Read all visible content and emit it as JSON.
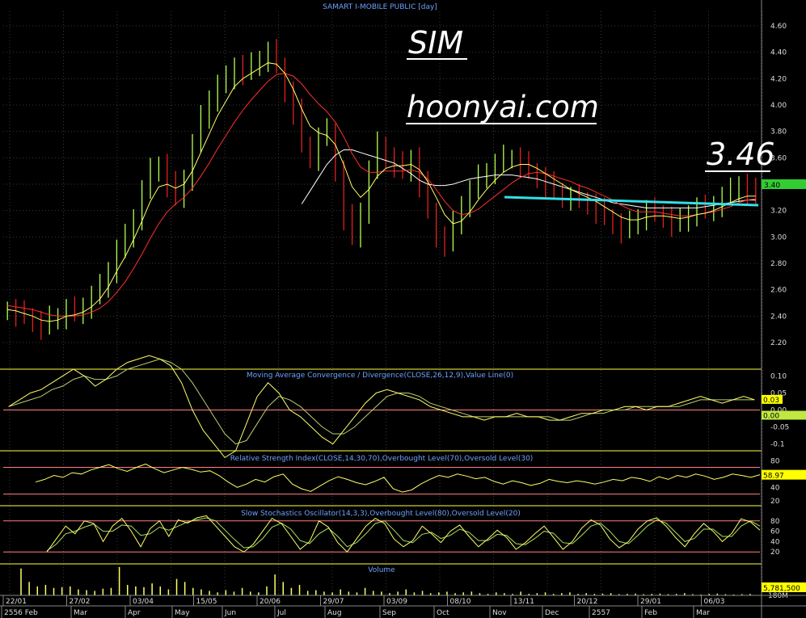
{
  "app_title": "SAMART I-MOBILE PUBLIC [day]",
  "annotations": {
    "symbol": "SIM",
    "website": "hoonyai.com",
    "price_label": "3.46"
  },
  "colors": {
    "background": "#000000",
    "price_up": "#b4ff50",
    "price_down": "#e02020",
    "ma_fast": "#ffff66",
    "ma_mid": "#ff3030",
    "ma_slow": "#ffffff",
    "support_line": "#33e0e8",
    "grid": "#3a3a3a",
    "divider": "#ffff40",
    "title_blue": "#6ea0ff",
    "label_box": "#ffff00",
    "current_price_box": "#33cc33"
  },
  "chart_data": [
    {
      "type": "line",
      "title": "SAMART I-MOBILE PUBLIC [day]",
      "panel": "price",
      "y_ticks": [
        "4.60",
        "4.40",
        "4.20",
        "4.00",
        "3.80",
        "3.60",
        "3.40",
        "3.20",
        "3.00",
        "2.80",
        "2.60",
        "2.40",
        "2.20"
      ],
      "ylim": [
        2.2,
        4.6
      ],
      "last_value": "3.40",
      "series": [
        {
          "values": [
            2.45,
            2.42,
            2.4,
            2.36,
            2.32,
            2.38,
            2.4,
            2.45,
            2.42,
            2.48,
            2.55,
            2.62,
            2.75,
            2.9,
            3.0,
            3.15,
            3.35,
            3.5,
            3.55,
            3.4,
            3.3,
            3.45,
            3.7,
            3.9,
            4.05,
            4.15,
            4.2,
            4.3,
            4.25,
            4.3,
            4.35,
            4.4,
            4.3,
            4.1,
            3.95,
            3.7,
            3.6,
            3.75,
            3.8,
            3.5,
            3.15,
            3.0,
            3.2,
            3.5,
            3.7,
            3.6,
            3.55,
            3.5,
            3.6,
            3.4,
            3.2,
            3.0,
            2.95,
            3.1,
            3.25,
            3.35,
            3.45,
            3.5,
            3.55,
            3.6,
            3.6,
            3.55,
            3.5,
            3.45,
            3.4,
            3.35,
            3.3,
            3.3,
            3.28,
            3.25,
            3.2,
            3.15,
            3.1,
            3.05,
            3.1,
            3.15,
            3.2,
            3.18,
            3.15,
            3.1,
            3.12,
            3.18,
            3.22,
            3.2,
            3.25,
            3.3,
            3.35,
            3.4,
            3.35,
            3.3
          ]
        },
        {
          "values": [
            2.45,
            2.44,
            2.42,
            2.4,
            2.37,
            2.36,
            2.37,
            2.4,
            2.41,
            2.43,
            2.47,
            2.53,
            2.62,
            2.74,
            2.85,
            2.98,
            3.12,
            3.27,
            3.38,
            3.4,
            3.37,
            3.4,
            3.5,
            3.64,
            3.78,
            3.92,
            4.03,
            4.14,
            4.2,
            4.24,
            4.28,
            4.32,
            4.31,
            4.24,
            4.12,
            3.97,
            3.84,
            3.79,
            3.77,
            3.7,
            3.55,
            3.38,
            3.3,
            3.36,
            3.46,
            3.52,
            3.54,
            3.54,
            3.55,
            3.51,
            3.42,
            3.3,
            3.17,
            3.1,
            3.12,
            3.19,
            3.28,
            3.36,
            3.43,
            3.49,
            3.53,
            3.55,
            3.55,
            3.52,
            3.48,
            3.44,
            3.4,
            3.36,
            3.33,
            3.3,
            3.27,
            3.23,
            3.19,
            3.15,
            3.13,
            3.13,
            3.15,
            3.16,
            3.16,
            3.15,
            3.14,
            3.15,
            3.17,
            3.18,
            3.2,
            3.23,
            3.26,
            3.29,
            3.31,
            3.31
          ]
        },
        {
          "values": [
            2.48,
            2.47,
            2.46,
            2.45,
            2.43,
            2.41,
            2.4,
            2.4,
            2.4,
            2.41,
            2.43,
            2.46,
            2.51,
            2.58,
            2.66,
            2.76,
            2.87,
            2.99,
            3.1,
            3.19,
            3.25,
            3.3,
            3.37,
            3.46,
            3.56,
            3.67,
            3.77,
            3.87,
            3.96,
            4.04,
            4.11,
            4.18,
            4.23,
            4.24,
            4.22,
            4.16,
            4.08,
            4.01,
            3.95,
            3.87,
            3.76,
            3.63,
            3.53,
            3.49,
            3.49,
            3.5,
            3.5,
            3.5,
            3.51,
            3.49,
            3.44,
            3.36,
            3.27,
            3.2,
            3.17,
            3.18,
            3.21,
            3.26,
            3.31,
            3.36,
            3.41,
            3.45,
            3.48,
            3.49,
            3.48,
            3.46,
            3.44,
            3.42,
            3.39,
            3.37,
            3.34,
            3.31,
            3.28,
            3.24,
            3.21,
            3.19,
            3.19,
            3.19,
            3.18,
            3.17,
            3.16,
            3.16,
            3.17,
            3.18,
            3.19,
            3.21,
            3.23,
            3.26,
            3.28,
            3.29
          ]
        },
        {
          "values": [
            null,
            null,
            null,
            null,
            null,
            null,
            null,
            null,
            null,
            null,
            null,
            null,
            null,
            null,
            null,
            null,
            null,
            null,
            null,
            null,
            null,
            null,
            null,
            null,
            null,
            null,
            null,
            null,
            null,
            null,
            null,
            null,
            null,
            null,
            null,
            3.25,
            3.35,
            3.45,
            3.55,
            3.62,
            3.66,
            3.66,
            3.64,
            3.62,
            3.6,
            3.58,
            3.56,
            3.52,
            3.48,
            3.43,
            3.4,
            3.39,
            3.39,
            3.4,
            3.42,
            3.44,
            3.45,
            3.46,
            3.47,
            3.47,
            3.47,
            3.46,
            3.45,
            3.44,
            3.42,
            3.4,
            3.38,
            3.36,
            3.34,
            3.32,
            3.3,
            3.28,
            3.26,
            3.25,
            3.24,
            3.23,
            3.22,
            3.22,
            3.22,
            3.22,
            3.22,
            3.22,
            3.22,
            3.23,
            3.24,
            3.25,
            3.26,
            3.27,
            3.28,
            3.28
          ]
        }
      ]
    },
    {
      "type": "line",
      "title": "Moving Average Convergence / Divergence(CLOSE,26,12,9),Value Line(0)",
      "panel": "macd",
      "y_ticks": [
        "0.10",
        "0.05",
        "0.00",
        "-0.05",
        "-0.1"
      ],
      "ylim": [
        -0.12,
        0.12
      ],
      "last_values": [
        "0.03",
        "0.00"
      ],
      "series": [
        {
          "values": [
            0.01,
            0.03,
            0.05,
            0.06,
            0.08,
            0.1,
            0.12,
            0.1,
            0.07,
            0.09,
            0.12,
            0.14,
            0.15,
            0.16,
            0.15,
            0.13,
            0.08,
            0.0,
            -0.06,
            -0.1,
            -0.14,
            -0.12,
            -0.04,
            0.04,
            0.08,
            0.05,
            0.0,
            -0.02,
            -0.05,
            -0.08,
            -0.1,
            -0.06,
            -0.02,
            0.02,
            0.05,
            0.06,
            0.05,
            0.04,
            0.03,
            0.01,
            0.0,
            -0.01,
            -0.02,
            -0.02,
            -0.03,
            -0.02,
            -0.02,
            -0.01,
            -0.02,
            -0.02,
            -0.03,
            -0.03,
            -0.02,
            -0.01,
            -0.01,
            0.0,
            0.0,
            0.01,
            0.01,
            0.0,
            0.01,
            0.01,
            0.02,
            0.03,
            0.04,
            0.03,
            0.02,
            0.03,
            0.04,
            0.03
          ]
        },
        {
          "values": [
            0.01,
            0.02,
            0.03,
            0.04,
            0.06,
            0.07,
            0.09,
            0.1,
            0.09,
            0.09,
            0.1,
            0.12,
            0.13,
            0.14,
            0.15,
            0.14,
            0.12,
            0.08,
            0.03,
            -0.02,
            -0.07,
            -0.1,
            -0.09,
            -0.04,
            0.01,
            0.04,
            0.03,
            0.01,
            -0.02,
            -0.05,
            -0.07,
            -0.07,
            -0.05,
            -0.02,
            0.01,
            0.04,
            0.05,
            0.05,
            0.04,
            0.02,
            0.01,
            0.0,
            -0.01,
            -0.02,
            -0.02,
            -0.02,
            -0.02,
            -0.02,
            -0.02,
            -0.02,
            -0.02,
            -0.03,
            -0.03,
            -0.02,
            -0.01,
            -0.01,
            0.0,
            0.0,
            0.01,
            0.01,
            0.01,
            0.01,
            0.01,
            0.02,
            0.03,
            0.03,
            0.03,
            0.03,
            0.03,
            0.03
          ]
        }
      ]
    },
    {
      "type": "line",
      "title": "Relative Strength Index(CLOSE,14,30,70),Overbought Level(70),Oversold Level(30)",
      "panel": "rsi",
      "y_ticks": [
        "80",
        "60",
        "40",
        "20"
      ],
      "ylim": [
        15,
        90
      ],
      "levels": [
        70,
        30
      ],
      "last_value": "58.97",
      "series": [
        {
          "values": [
            48,
            52,
            58,
            55,
            62,
            60,
            66,
            70,
            74,
            68,
            64,
            70,
            75,
            68,
            62,
            66,
            70,
            67,
            63,
            65,
            58,
            48,
            40,
            45,
            52,
            48,
            56,
            60,
            45,
            38,
            34,
            42,
            50,
            56,
            52,
            47,
            44,
            49,
            55,
            38,
            33,
            36,
            45,
            52,
            58,
            55,
            60,
            57,
            53,
            55,
            49,
            45,
            50,
            47,
            43,
            46,
            52,
            49,
            47,
            50,
            48,
            45,
            48,
            52,
            50,
            55,
            53,
            49,
            56,
            52,
            58,
            55,
            60,
            57,
            52,
            55,
            60,
            58,
            55,
            59
          ]
        }
      ]
    },
    {
      "type": "line",
      "title": "Slow Stochastics Oscillator(14,3,3),Overbought Level(80),Oversold Level(20)",
      "panel": "stochastic",
      "y_ticks": [
        "80",
        "60",
        "40",
        "20"
      ],
      "ylim": [
        0,
        100
      ],
      "levels": [
        80,
        20
      ],
      "series": [
        {
          "values": [
            20,
            45,
            70,
            55,
            80,
            75,
            40,
            70,
            85,
            60,
            30,
            65,
            80,
            50,
            82,
            76,
            86,
            90,
            70,
            50,
            30,
            20,
            35,
            60,
            85,
            75,
            50,
            25,
            40,
            80,
            68,
            38,
            20,
            45,
            70,
            85,
            75,
            45,
            30,
            42,
            70,
            55,
            38,
            60,
            72,
            50,
            30,
            45,
            62,
            48,
            25,
            38,
            55,
            70,
            48,
            25,
            40,
            66,
            82,
            72,
            45,
            28,
            40,
            64,
            80,
            86,
            70,
            48,
            30,
            55,
            75,
            60,
            40,
            56,
            84,
            78,
            62
          ]
        },
        {
          "values": [
            22,
            35,
            55,
            60,
            68,
            74,
            60,
            60,
            72,
            70,
            52,
            55,
            68,
            62,
            70,
            78,
            82,
            86,
            80,
            62,
            44,
            28,
            30,
            46,
            68,
            76,
            64,
            42,
            36,
            55,
            66,
            50,
            30,
            38,
            55,
            75,
            80,
            62,
            42,
            38,
            54,
            58,
            46,
            52,
            64,
            58,
            42,
            42,
            54,
            52,
            36,
            34,
            46,
            60,
            56,
            38,
            36,
            52,
            70,
            76,
            60,
            40,
            36,
            52,
            70,
            82,
            76,
            58,
            40,
            46,
            64,
            64,
            50,
            50,
            70,
            80,
            70
          ]
        }
      ]
    },
    {
      "type": "bar",
      "title": "Volume",
      "panel": "volume",
      "y_ticks": [
        "180M"
      ],
      "last_value": "5,781,500",
      "values": [
        180,
        90,
        60,
        70,
        50,
        55,
        60,
        40,
        35,
        30,
        45,
        50,
        190,
        70,
        60,
        55,
        80,
        60,
        40,
        110,
        90,
        50,
        40,
        30,
        20,
        35,
        25,
        50,
        25,
        20,
        60,
        140,
        90,
        50,
        70,
        30,
        35,
        25,
        20,
        40,
        25,
        20,
        50,
        30,
        25,
        15,
        25,
        40,
        20,
        30,
        15,
        20,
        25,
        15,
        20,
        25,
        15,
        10,
        20,
        15,
        10,
        25,
        10,
        15,
        20,
        10,
        15,
        20,
        10,
        15,
        10,
        12,
        15,
        8,
        10,
        12,
        8,
        10,
        12,
        8,
        10,
        15,
        8,
        6,
        10,
        12,
        8,
        6,
        8,
        10
      ]
    },
    {
      "type": "table",
      "title": "time axis",
      "date_labels": [
        "22/01",
        "27/02",
        "03/04",
        "15/05",
        "20/06",
        "29/07",
        "03/09",
        "08/10",
        "13/11",
        "20/12",
        "29/01",
        "06/03"
      ],
      "month_labels": [
        "2556 Feb",
        "Mar",
        "Apr",
        "May",
        "Jun",
        "Jul",
        "Aug",
        "Sep",
        "Oct",
        "Nov",
        "Dec",
        "2557",
        "Feb",
        "Mar"
      ]
    }
  ]
}
